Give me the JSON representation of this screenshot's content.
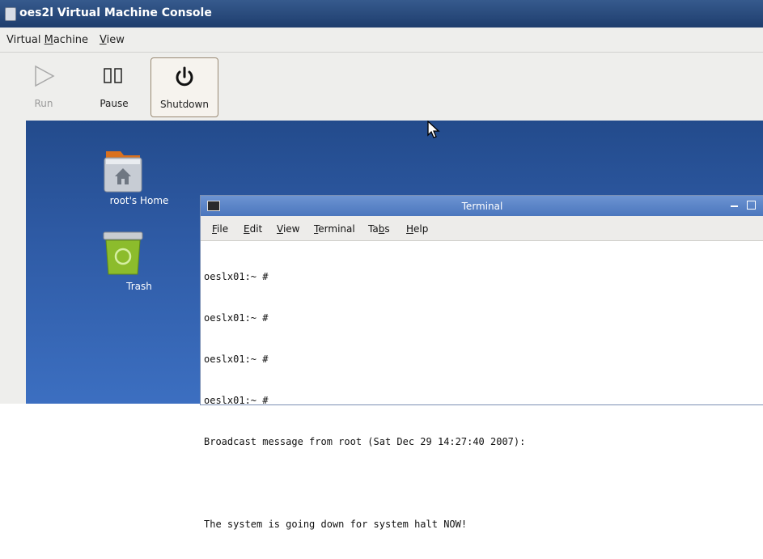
{
  "window": {
    "title": "oes2l Virtual Machine Console",
    "title_icon": "vm-console-icon"
  },
  "menubar": {
    "items": [
      {
        "label": "Virtual Machine",
        "mnemonic": "M"
      },
      {
        "label": "View",
        "mnemonic": "V"
      }
    ]
  },
  "toolbar": {
    "run_label": "Run",
    "pause_label": "Pause",
    "shutdown_label": "Shutdown",
    "run_icon": "play-icon",
    "pause_icon": "pause-icon",
    "shutdown_icon": "power-icon"
  },
  "desktop": {
    "icons": [
      {
        "label": "root's Home",
        "icon": "home-folder-icon"
      },
      {
        "label": "Trash",
        "icon": "trash-icon"
      }
    ],
    "background_color": "#2e5aa4"
  },
  "terminal": {
    "title": "Terminal",
    "menu": [
      "File",
      "Edit",
      "View",
      "Terminal",
      "Tabs",
      "Help"
    ],
    "lines": [
      "oeslx01:~ #",
      "oeslx01:~ #",
      "oeslx01:~ #",
      "oeslx01:~ #",
      "Broadcast message from root (Sat Dec 29 14:27:40 2007):",
      "",
      "The system is going down for system halt NOW!"
    ]
  },
  "colors": {
    "titlebar": "#2b4c7e",
    "terminal_titlebar": "#5b84c8"
  }
}
